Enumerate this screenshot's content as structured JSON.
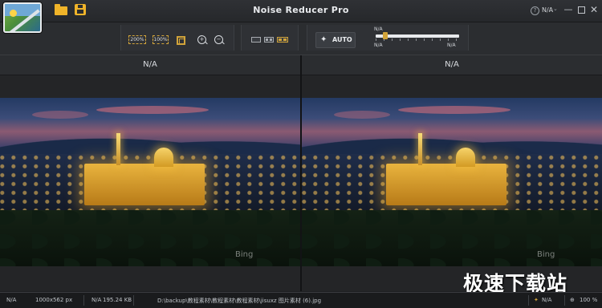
{
  "window": {
    "title": "Noise Reducer Pro",
    "language": "N/A"
  },
  "toolbar": {
    "zoom_200_label": "200%",
    "zoom_100_label": "100%",
    "auto_label": "AUTO",
    "slider": {
      "title": "N/A",
      "min_label": "N/A",
      "max_label": "N/A",
      "value": 0.12
    }
  },
  "panes": {
    "left_title": "N/A",
    "right_title": "N/A",
    "image_watermark": "Bing"
  },
  "statusbar": {
    "left_label": "N/A",
    "dimensions": "1000x562 px",
    "size_label": "N/A",
    "file_size": "195.24 KB",
    "file_path": "D:\\backup\\教程素材\\教程素材\\教程素材\\jisuxz 图片素材 (6).jpg",
    "strength_label": "N/A",
    "zoom": "100 %"
  },
  "brand_watermark": "极速下载站",
  "colors": {
    "accent": "#d2a43a",
    "background": "#1e1f21",
    "toolbar": "#2b2d30"
  }
}
